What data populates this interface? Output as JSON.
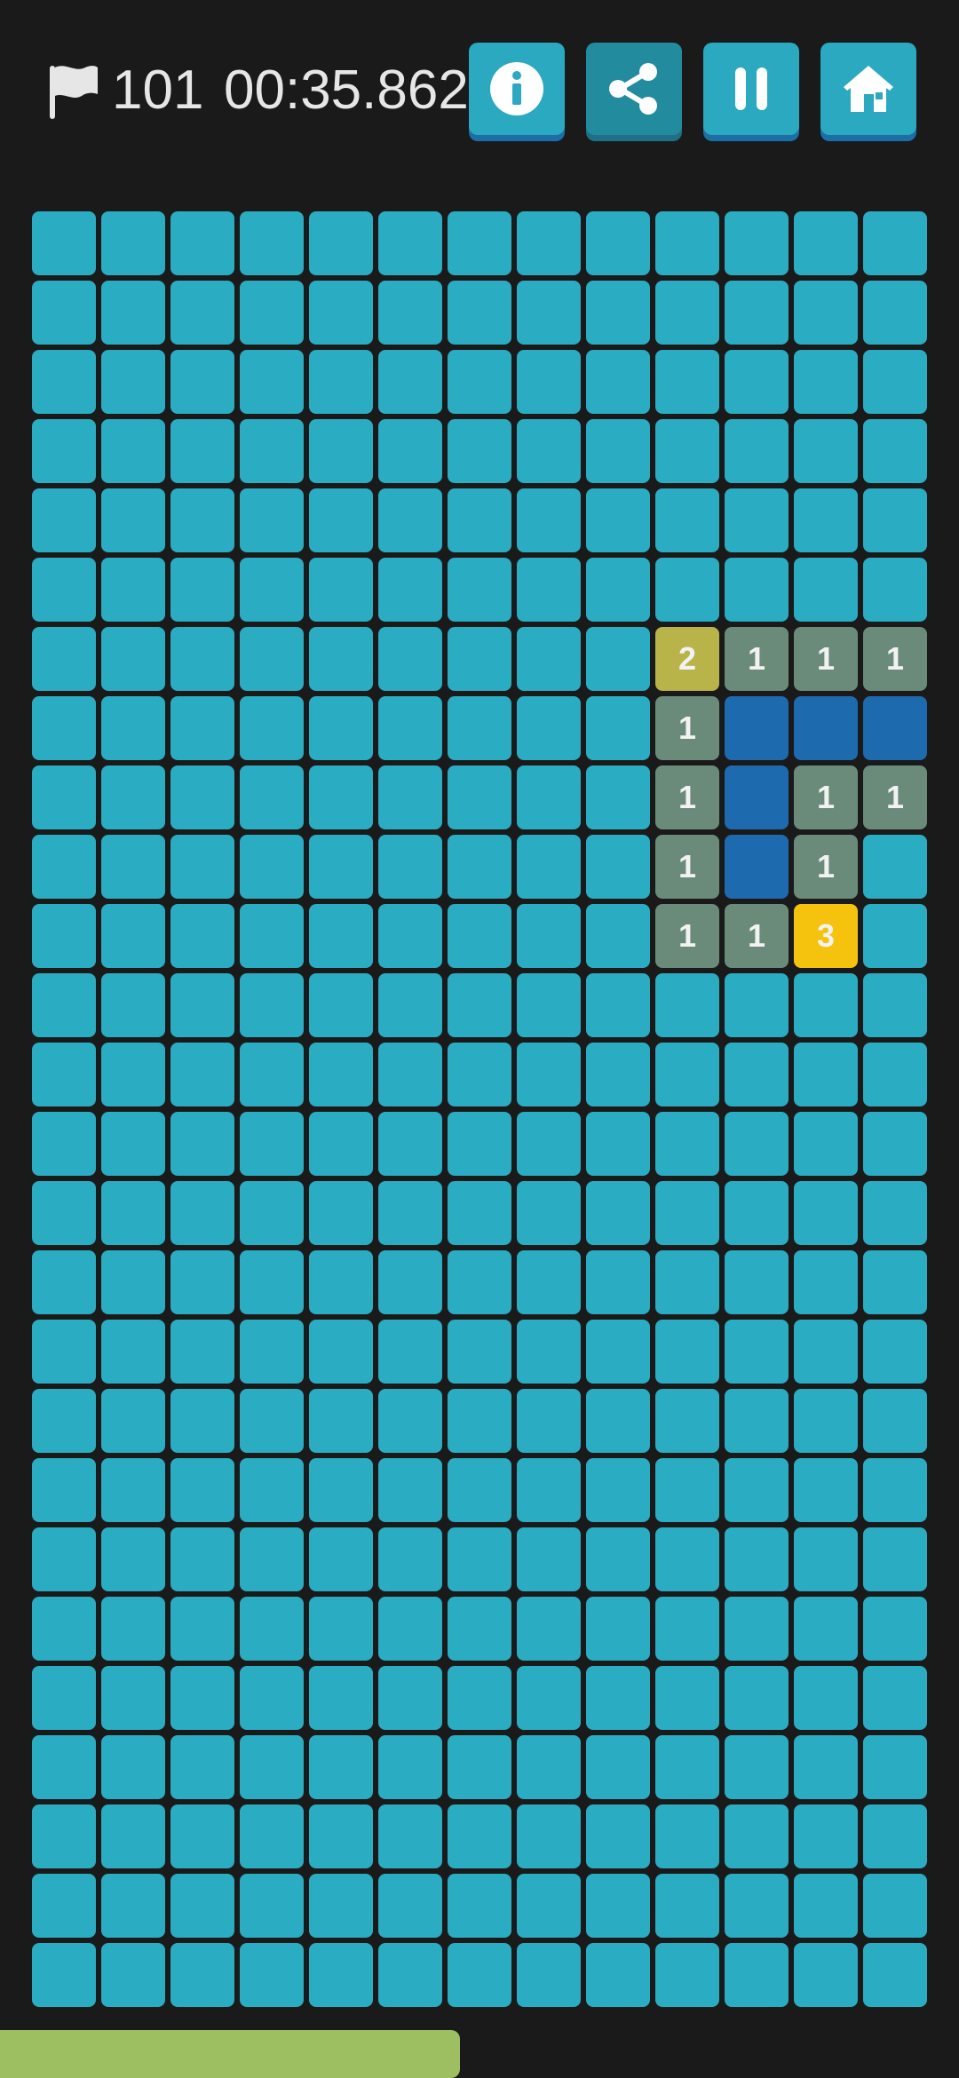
{
  "header": {
    "flag_icon": "flag-icon",
    "flags_remaining": "101",
    "timer": "00:35.862"
  },
  "toolbar": [
    {
      "name": "info-button",
      "icon": "info-icon",
      "active": false
    },
    {
      "name": "share-button",
      "icon": "share-icon",
      "active": true
    },
    {
      "name": "pause-button",
      "icon": "pause-icon",
      "active": false
    },
    {
      "name": "home-button",
      "icon": "home-icon",
      "active": false
    }
  ],
  "board": {
    "columns": 13,
    "rows": 26,
    "revealed": [
      {
        "row": 6,
        "col": 9,
        "value": "2",
        "style": "olive"
      },
      {
        "row": 6,
        "col": 10,
        "value": "1",
        "style": "open"
      },
      {
        "row": 6,
        "col": 11,
        "value": "1",
        "style": "open"
      },
      {
        "row": 6,
        "col": 12,
        "value": "1",
        "style": "open"
      },
      {
        "row": 7,
        "col": 9,
        "value": "1",
        "style": "open"
      },
      {
        "row": 7,
        "col": 10,
        "value": "",
        "style": "blank"
      },
      {
        "row": 7,
        "col": 11,
        "value": "",
        "style": "blank"
      },
      {
        "row": 7,
        "col": 12,
        "value": "",
        "style": "blank"
      },
      {
        "row": 8,
        "col": 9,
        "value": "1",
        "style": "open"
      },
      {
        "row": 8,
        "col": 10,
        "value": "",
        "style": "blank"
      },
      {
        "row": 8,
        "col": 11,
        "value": "1",
        "style": "open"
      },
      {
        "row": 8,
        "col": 12,
        "value": "1",
        "style": "open"
      },
      {
        "row": 9,
        "col": 9,
        "value": "1",
        "style": "open"
      },
      {
        "row": 9,
        "col": 10,
        "value": "",
        "style": "blank"
      },
      {
        "row": 9,
        "col": 11,
        "value": "1",
        "style": "open"
      },
      {
        "row": 10,
        "col": 9,
        "value": "1",
        "style": "open"
      },
      {
        "row": 10,
        "col": 10,
        "value": "1",
        "style": "open"
      },
      {
        "row": 10,
        "col": 11,
        "value": "3",
        "style": "yellow"
      }
    ]
  },
  "progress": {
    "fraction": 0.48
  },
  "colors": {
    "background": "#1a1a1a",
    "hidden_cell": "#2aacc2",
    "revealed_number": "#6b8b7a",
    "revealed_blank": "#1d6aaf",
    "highlight_olive": "#b8b44a",
    "highlight_yellow": "#f5c20e",
    "progress_bar": "#9dbf62"
  }
}
